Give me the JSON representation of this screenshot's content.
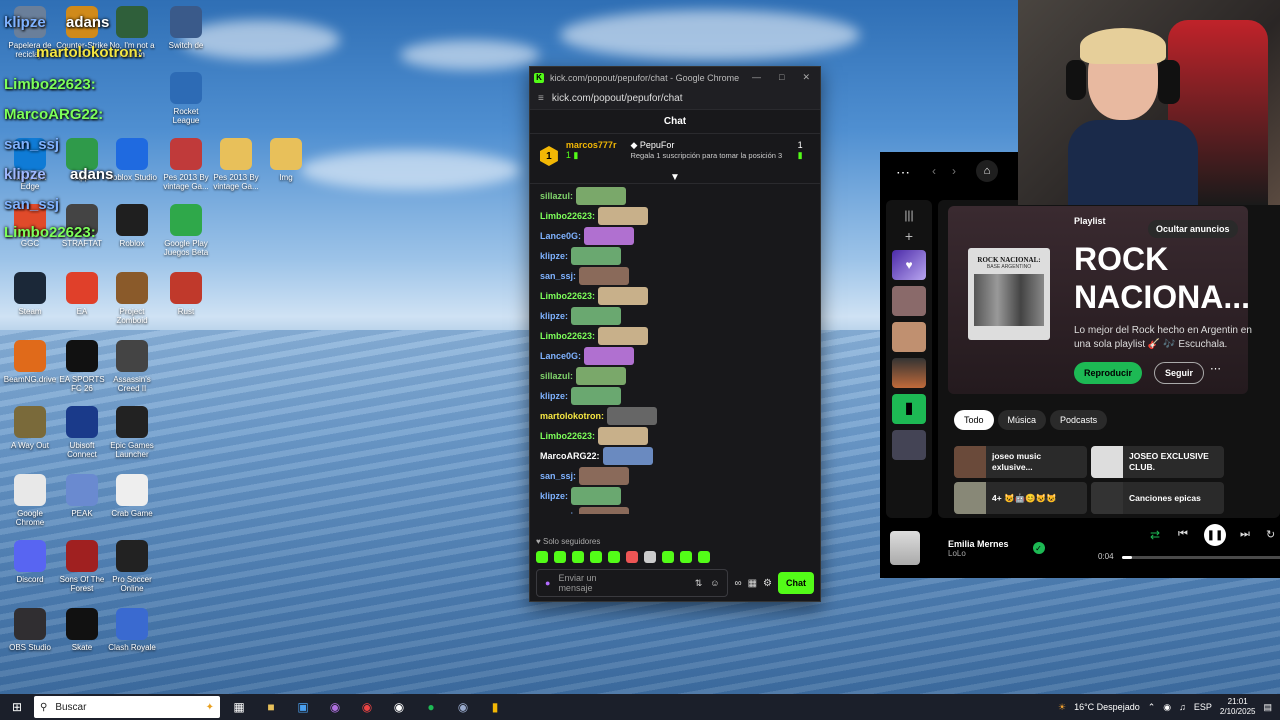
{
  "desktop": {
    "icons": [
      {
        "label": "Papelera de reciclaje",
        "color": "#6a7f9a"
      },
      {
        "label": "Counter-Strike 2",
        "color": "#d08a1a"
      },
      {
        "label": "No, I'm not a Human",
        "color": "#2f5f3a"
      },
      {
        "label": "Switch de",
        "color": "#3a5a8a"
      },
      {
        "label": "Rocket League",
        "color": "#2d6bb5"
      },
      {
        "label": "Microsoft Edge",
        "color": "#0f7bd6"
      },
      {
        "label": "App",
        "color": "#2f9a4a"
      },
      {
        "label": "Roblox Studio",
        "color": "#1f6ae0"
      },
      {
        "label": "Pes 2013 By vintage Ga...",
        "color": "#c03a3a"
      },
      {
        "label": "Pes 2013 By vintage Ga...",
        "color": "#e8c05a"
      },
      {
        "label": "Img",
        "color": "#e8c05a"
      },
      {
        "label": "GGC",
        "color": "#e04a2a"
      },
      {
        "label": "STRAFTAT",
        "color": "#444"
      },
      {
        "label": "Roblox",
        "color": "#1f1f1f"
      },
      {
        "label": "Google Play Juegos Beta",
        "color": "#2fa84a"
      },
      {
        "label": "Steam",
        "color": "#1b2838"
      },
      {
        "label": "EA",
        "color": "#e0402a"
      },
      {
        "label": "Project Zomboid",
        "color": "#8a5a2a"
      },
      {
        "label": "Rust",
        "color": "#c0392b"
      },
      {
        "label": "BeamNG.drive",
        "color": "#e06a1a"
      },
      {
        "label": "EA SPORTS FC 26",
        "color": "#111"
      },
      {
        "label": "Assassin's Creed II",
        "color": "#444"
      },
      {
        "label": "A Way Out",
        "color": "#7a6a3a"
      },
      {
        "label": "Ubisoft Connect",
        "color": "#1a3a8a"
      },
      {
        "label": "Epic Games Launcher",
        "color": "#222"
      },
      {
        "label": "Google Chrome",
        "color": "#e8e8e8"
      },
      {
        "label": "PEAK",
        "color": "#6a8ad0"
      },
      {
        "label": "Crab Game",
        "color": "#eee"
      },
      {
        "label": "Discord",
        "color": "#5865f2"
      },
      {
        "label": "Sons Of The Forest",
        "color": "#a02020"
      },
      {
        "label": "Pro Soccer Online",
        "color": "#222"
      },
      {
        "label": "OBS Studio",
        "color": "#302e31"
      },
      {
        "label": "Skate",
        "color": "#111"
      },
      {
        "label": "Clash Royale",
        "color": "#3a6ad0"
      }
    ],
    "overlay_names": [
      {
        "text": "klipze",
        "color": "#7fb2ff"
      },
      {
        "text": "adans",
        "color": "#ffffff"
      },
      {
        "text": "martolokotron:",
        "color": "#f5e642"
      },
      {
        "text": "Limbo22623:",
        "color": "#7dff5a"
      },
      {
        "text": "MarcoARG22:",
        "color": "#7dff5a"
      },
      {
        "text": "san_ssj",
        "color": "#7fb2ff"
      },
      {
        "text": "klipze",
        "color": "#9fb8ff"
      },
      {
        "text": "adans",
        "color": "#ffffff"
      },
      {
        "text": "san_ssj",
        "color": "#7fb2ff"
      },
      {
        "text": "Limbo22623:",
        "color": "#7dff5a"
      }
    ]
  },
  "chat_window": {
    "title": "kick.com/popout/pepufor/chat - Google Chrome",
    "url": "kick.com/popout/pepufor/chat",
    "header": "Chat",
    "pinned": {
      "rank": "1",
      "user": "marcos777r",
      "user_count": "1",
      "target": "PepuFor",
      "target_count": "1",
      "text": "Regala 1 suscripción para tomar la posición 3"
    },
    "messages": [
      {
        "user": "sillazul:",
        "color": "#7fd36b",
        "emote_color": "#7aa86a"
      },
      {
        "user": "Limbo22623:",
        "color": "#7dff5a",
        "emote_color": "#c8b08a"
      },
      {
        "user": "Lance0G:",
        "color": "#7fb2ff",
        "emote_color": "#b070d0"
      },
      {
        "user": "klipze:",
        "color": "#7fb2ff",
        "emote_color": "#6aa870"
      },
      {
        "user": "san_ssj:",
        "color": "#7fb2ff",
        "emote_color": "#8a6a5a"
      },
      {
        "user": "Limbo22623:",
        "color": "#7dff5a",
        "emote_color": "#c8b08a"
      },
      {
        "user": "klipze:",
        "color": "#7fb2ff",
        "emote_color": "#6aa870"
      },
      {
        "user": "Limbo22623:",
        "color": "#7dff5a",
        "emote_color": "#c8b08a"
      },
      {
        "user": "Lance0G:",
        "color": "#7fb2ff",
        "emote_color": "#b070d0"
      },
      {
        "user": "sillazul:",
        "color": "#7fd36b",
        "emote_color": "#7aa86a"
      },
      {
        "user": "klipze:",
        "color": "#7fb2ff",
        "emote_color": "#6aa870"
      },
      {
        "user": "martolokotron:",
        "color": "#f5e642",
        "emote_color": "#666"
      },
      {
        "user": "Limbo22623:",
        "color": "#7dff5a",
        "emote_color": "#c8b08a"
      },
      {
        "user": "MarcoARG22:",
        "color": "#ffffff",
        "emote_color": "#6a8ac0"
      },
      {
        "user": "san_ssj:",
        "color": "#7fb2ff",
        "emote_color": "#8a6a5a"
      },
      {
        "user": "klipze:",
        "color": "#7fb2ff",
        "emote_color": "#6aa870"
      },
      {
        "user": "san_ssj:",
        "color": "#7fb2ff",
        "emote_color": "#8a6a5a"
      }
    ],
    "followers_only": "Solo seguidores",
    "input_placeholder": "Enviar un mensaje",
    "send_label": "Chat"
  },
  "spotify": {
    "playlist_type": "Playlist",
    "hide_ads": "Ocultar anuncios",
    "cover_text": "ROCK NACIONAL:",
    "cover_sub": "BASE ARGENTINO",
    "title": "ROCK NACIONA...",
    "description": "Lo mejor del Rock hecho en Argentin en una sola playlist 🎸 🎶 Escuchala.",
    "play": "Reproducir",
    "follow": "Seguir",
    "chips": [
      "Todo",
      "Música",
      "Podcasts"
    ],
    "tiles": [
      {
        "label": "joseo music exlusive...",
        "color": "#6a4a3a"
      },
      {
        "label": "JOSEO EXCLUSIVE CLUB.",
        "color": "#ddd"
      },
      {
        "label": "4+ 😺🤖😊😺😺",
        "color": "#887"
      },
      {
        "label": "Canciones epicas",
        "color": "#333"
      }
    ],
    "now_playing": {
      "title": "Emilia Mernes",
      "artist": "LoLo",
      "time": "0:04"
    }
  },
  "taskbar": {
    "search": "Buscar",
    "weather": "16°C Despejado",
    "lang": "ESP",
    "time": "21:01",
    "date": "2/10/2025"
  }
}
